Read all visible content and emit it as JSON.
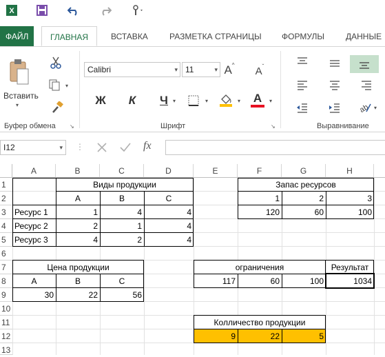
{
  "app": {
    "brand_color": "#217346"
  },
  "tabs": [
    {
      "label": "ФАЙЛ"
    },
    {
      "label": "ГЛАВНАЯ"
    },
    {
      "label": "ВСТАВКА"
    },
    {
      "label": "РАЗМЕТКА СТРАНИЦЫ"
    },
    {
      "label": "ФОРМУЛЫ"
    },
    {
      "label": "ДАННЫЕ"
    }
  ],
  "ribbon": {
    "paste_label": "Вставить",
    "clipboard_group": "Буфер обмена",
    "font_group": "Шрифт",
    "align_group": "Выравнивание",
    "font_name": "Calibri",
    "font_size": "11",
    "bold": "Ж",
    "italic": "К",
    "underline": "Ч",
    "grow_font": "A",
    "shrink_font": "A",
    "font_color_letter": "A",
    "fill_color": "#ffc000",
    "font_color": "#e81123"
  },
  "formula_bar": {
    "name_box": "I12",
    "formula": ""
  },
  "columns": [
    "A",
    "B",
    "C",
    "D",
    "E",
    "F",
    "G",
    "H"
  ],
  "rows": [
    "1",
    "2",
    "3",
    "4",
    "5",
    "6",
    "7",
    "8",
    "9",
    "10",
    "11",
    "12",
    "13"
  ],
  "cells": {
    "B1": "Виды продукции",
    "F1": "Запас ресурсов",
    "B2": "A",
    "C2": "B",
    "D2": "C",
    "F2": "1",
    "G2": "2",
    "H2": "3",
    "A3": "Ресурс 1",
    "B3": "1",
    "C3": "4",
    "D3": "4",
    "F3": "120",
    "G3": "60",
    "H3": "100",
    "A4": "Ресурс 2",
    "B4": "2",
    "C4": "1",
    "D4": "4",
    "A5": "Ресурс 3",
    "B5": "4",
    "C5": "2",
    "D5": "4",
    "A7": "Цена продукции",
    "E7": "ограничения",
    "H7": "Результат",
    "A8": "A",
    "B8": "B",
    "C8": "C",
    "E8": "117",
    "F8": "60",
    "G8": "100",
    "H8": "1034",
    "A9": "30",
    "B9": "22",
    "C9": "56",
    "E11": "Колличество продукции",
    "E12": "9",
    "F12": "22",
    "G12": "5"
  },
  "highlight_color": "#ffc000"
}
